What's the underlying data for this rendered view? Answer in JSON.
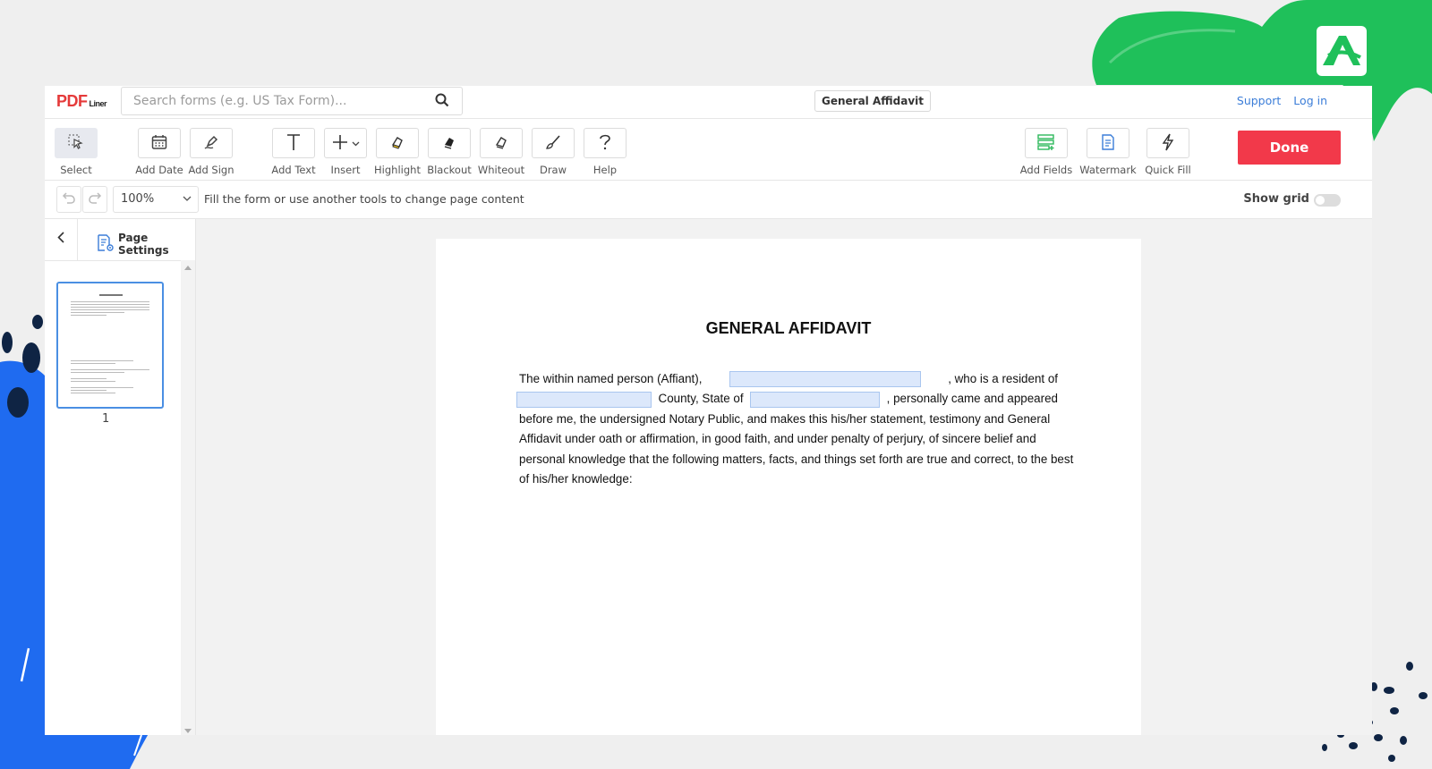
{
  "brand": {
    "logo_main": "PDF",
    "logo_sub": "Liner"
  },
  "search": {
    "placeholder": "Search forms (e.g. US Tax Form)..."
  },
  "document": {
    "title": "General Affidavit"
  },
  "top_links": {
    "support": "Support",
    "login": "Log in"
  },
  "toolbar": {
    "tools": {
      "select": "Select",
      "add_date": "Add Date",
      "add_sign": "Add Sign",
      "add_text": "Add Text",
      "insert": "Insert",
      "highlight": "Highlight",
      "blackout": "Blackout",
      "whiteout": "Whiteout",
      "draw": "Draw",
      "help": "Help",
      "add_fields": "Add Fields",
      "watermark": "Watermark",
      "quick_fill": "Quick Fill"
    },
    "done": "Done"
  },
  "subbar": {
    "zoom": "100%",
    "hint": "Fill the form or use another tools to change page content",
    "show_grid": "Show grid"
  },
  "sidebar": {
    "page_settings": "Page Settings",
    "pages": [
      "1"
    ]
  },
  "page": {
    "heading": "GENERAL AFFIDAVIT",
    "line1_a": "The within named person (Affiant),",
    "line1_b": ", who is a resident of",
    "line2_a": "County, State of",
    "line2_b": ", personally came and appeared",
    "line3": "before me, the undersigned Notary Public, and makes this his/her statement, testimony and General",
    "line4": "Affidavit under oath or affirmation, in good faith, and under penalty of perjury, of sincere belief and",
    "line5": "personal knowledge that the following matters, facts, and things set forth are true and correct, to the best",
    "line6": "of his/her knowledge:"
  },
  "colors": {
    "accent_red": "#f2394a",
    "link_blue": "#3b7dd8",
    "thumb_border": "#4a8fe3",
    "field_fill": "#dce8fb",
    "deco_green": "#1fc05a",
    "deco_blue": "#1f6bf0",
    "deco_navy": "#0f2444"
  },
  "icons": [
    "search-icon",
    "select-cursor-icon",
    "calendar-icon",
    "sign-pen-icon",
    "text-icon",
    "plus-icon",
    "chevron-down-icon",
    "highlight-icon",
    "blackout-icon",
    "whiteout-icon",
    "draw-brush-icon",
    "help-icon",
    "add-fields-icon",
    "watermark-icon",
    "lightning-icon",
    "undo-icon",
    "redo-icon",
    "chevron-left-icon",
    "page-settings-icon",
    "pdf-badge-icon"
  ]
}
